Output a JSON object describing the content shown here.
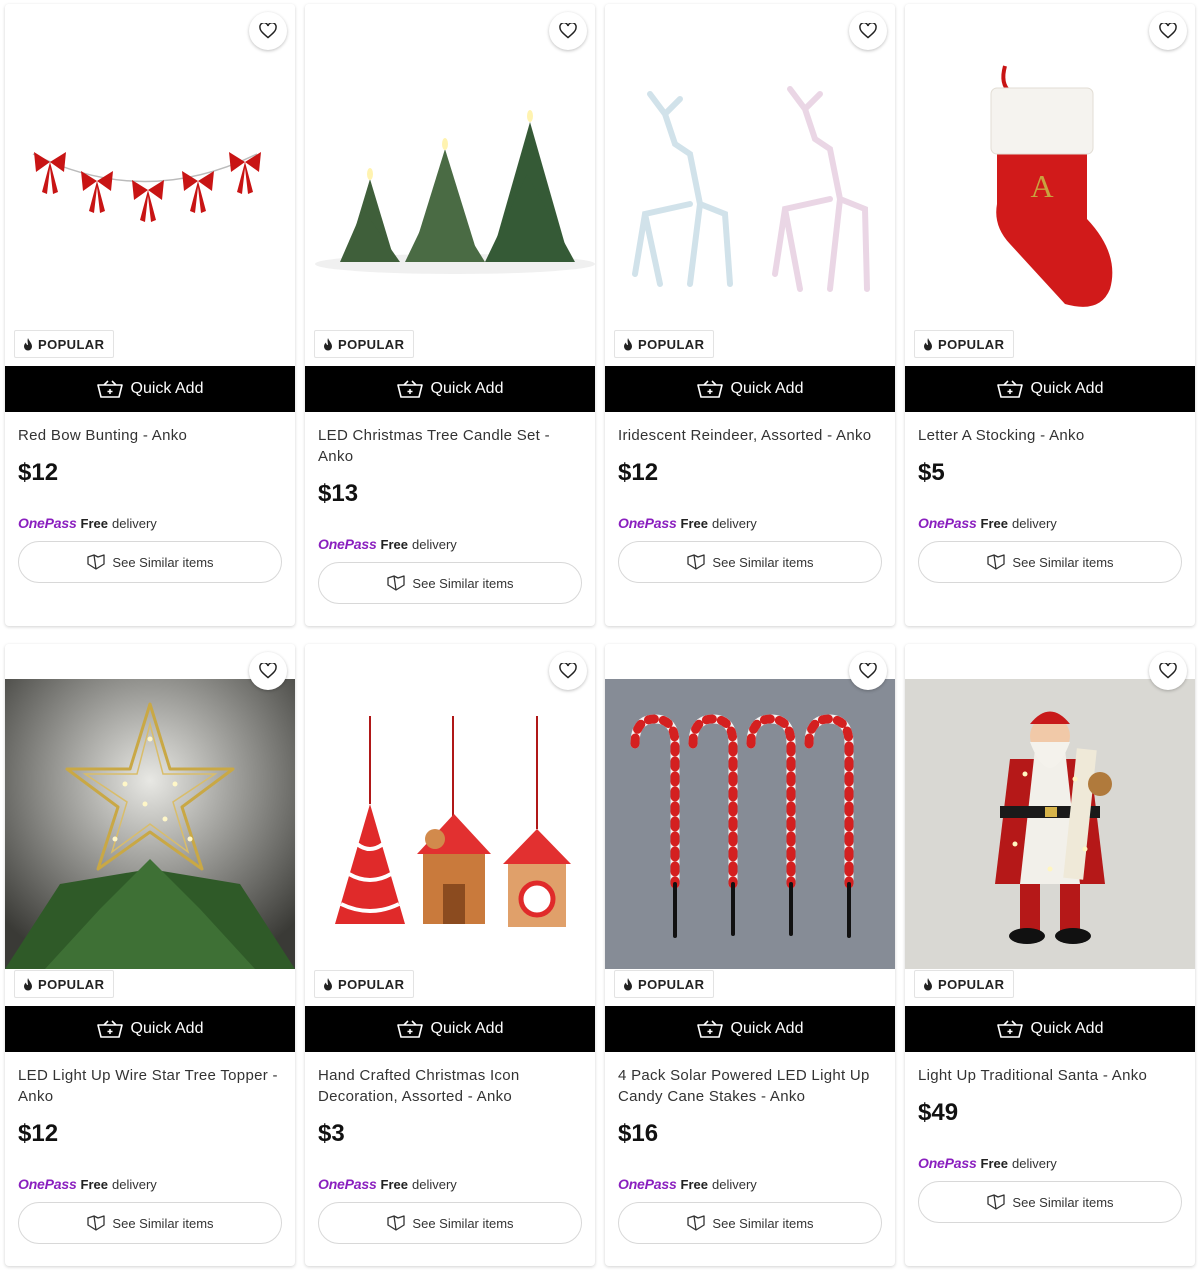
{
  "badge_label": "POPULAR",
  "quick_add_label": "Quick Add",
  "onepass": {
    "brand": "OnePass",
    "free": "Free",
    "delivery": "delivery"
  },
  "similar_label": "See Similar items",
  "colors": {
    "onepass_purple": "#8a1fbf",
    "quick_add_bg": "#000000"
  },
  "products": [
    {
      "title": "Red Bow Bunting - Anko",
      "price": "$12",
      "image": "red-bow-bunting"
    },
    {
      "title": "LED Christmas Tree Candle Set - Anko",
      "price": "$13",
      "image": "tree-candles"
    },
    {
      "title": "Iridescent Reindeer, Assorted - Anko",
      "price": "$12",
      "image": "reindeer"
    },
    {
      "title": "Letter A Stocking - Anko",
      "price": "$5",
      "image": "stocking",
      "stocking_letter": "A"
    },
    {
      "title": "LED Light Up Wire Star Tree Topper - Anko",
      "price": "$12",
      "image": "star-topper"
    },
    {
      "title": "Hand Crafted Christmas Icon Decoration, Assorted - Anko",
      "price": "$3",
      "image": "icon-ornaments"
    },
    {
      "title": "4 Pack Solar Powered LED Light Up Candy Cane Stakes - Anko",
      "price": "$16",
      "image": "candy-canes"
    },
    {
      "title": "Light Up Traditional Santa - Anko",
      "price": "$49",
      "image": "santa"
    }
  ]
}
